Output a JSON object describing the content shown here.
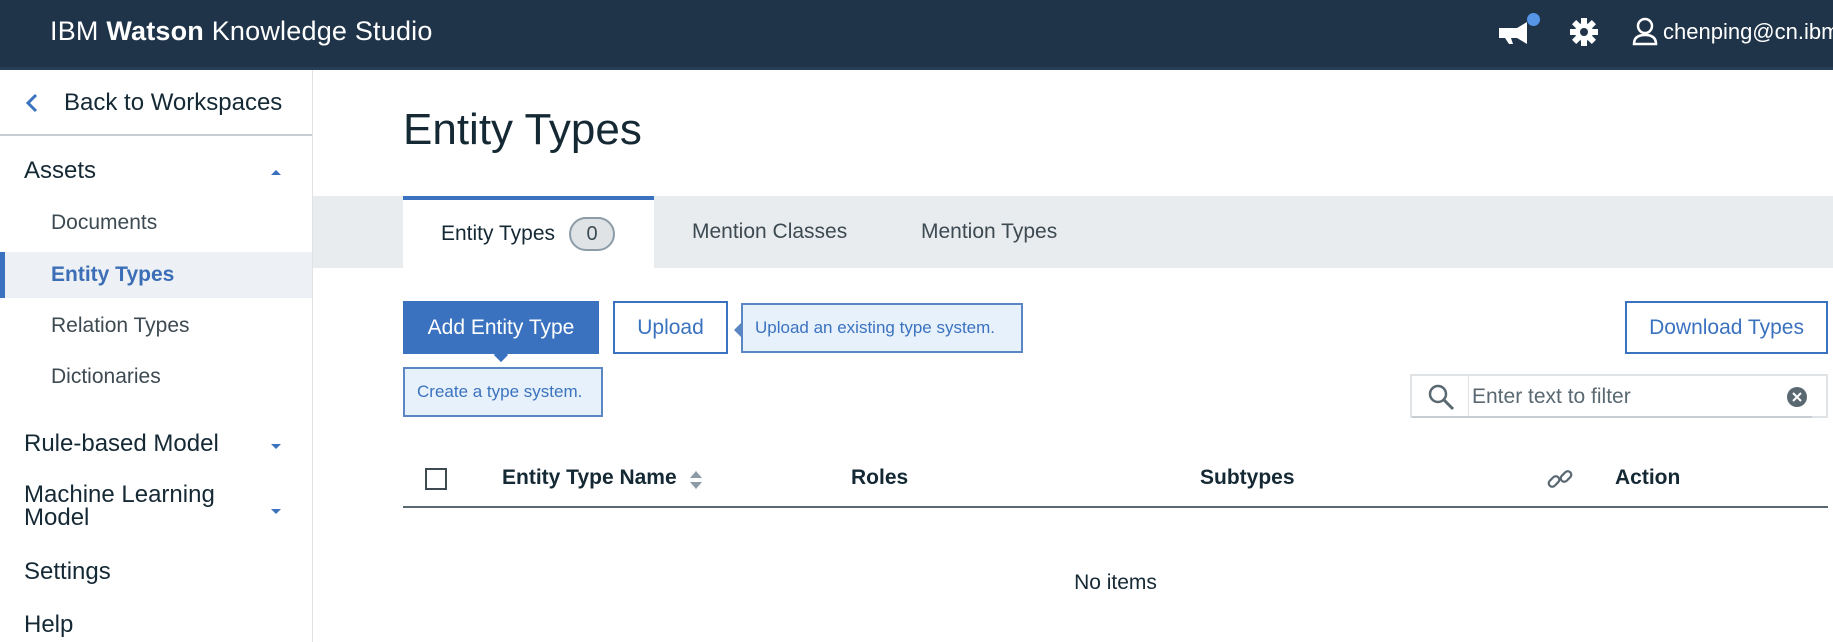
{
  "header": {
    "brand_prefix": "IBM",
    "brand_bold": "Watson",
    "brand_suffix": "Knowledge Studio",
    "user": "chenping@cn.ibm"
  },
  "sidebar": {
    "back_label": "Back to Workspaces",
    "assets_label": "Assets",
    "asset_items": [
      "Documents",
      "Entity Types",
      "Relation Types",
      "Dictionaries"
    ],
    "active_item": "Entity Types",
    "rule_model_label": "Rule-based Model",
    "ml_model_label_line1": "Machine Learning",
    "ml_model_label_line2": "Model",
    "settings_label": "Settings",
    "help_label": "Help"
  },
  "main": {
    "title": "Entity Types",
    "tabs": [
      {
        "label": "Entity Types",
        "count": "0"
      },
      {
        "label": "Mention Classes"
      },
      {
        "label": "Mention Types"
      }
    ],
    "add_button": "Add Entity Type",
    "upload_button": "Upload",
    "upload_tooltip": "Upload an existing type system.",
    "add_tooltip": "Create a type system.",
    "download_button": "Download Types",
    "filter_placeholder": "Enter text to filter",
    "columns": [
      "Entity Type Name",
      "Roles",
      "Subtypes",
      "Action"
    ],
    "empty_text": "No items"
  },
  "colors": {
    "header_bg": "#1f3449",
    "accent": "#3b72bf",
    "tab_bg": "#e8ecee",
    "notification_dot": "#5596e6"
  },
  "icons": [
    "megaphone-icon",
    "gear-icon",
    "user-icon",
    "chevron-left-icon",
    "caret-up-icon",
    "caret-down-icon",
    "search-icon",
    "clear-icon",
    "sort-icon",
    "link-icon"
  ]
}
